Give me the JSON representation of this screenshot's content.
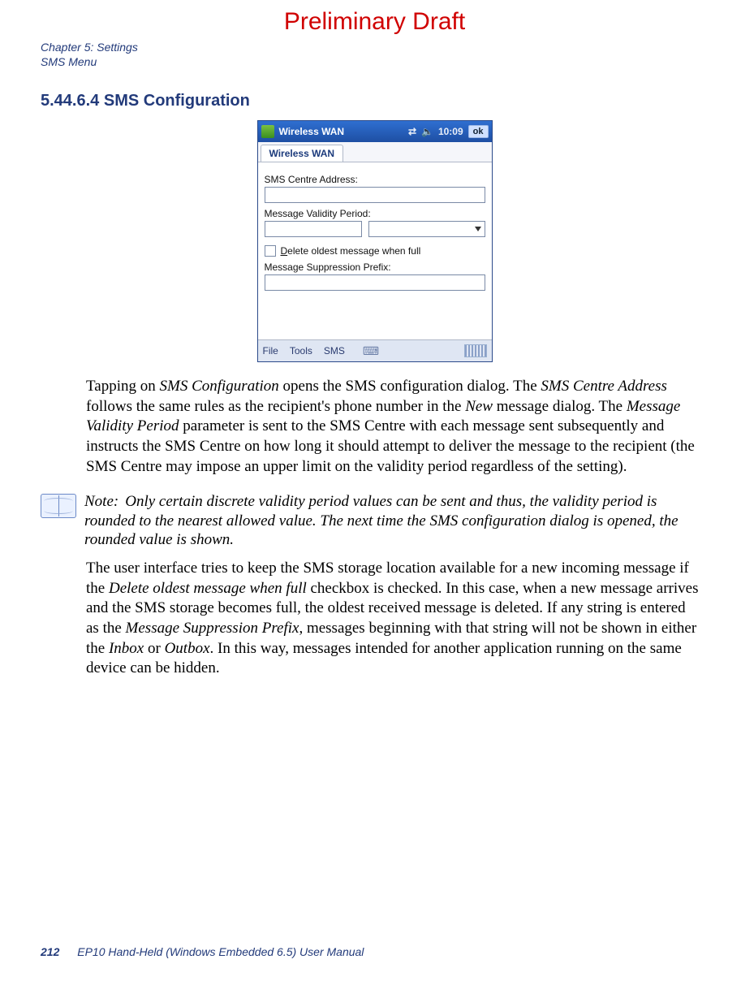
{
  "draft_header": "Preliminary Draft",
  "chapter_line": "Chapter 5: Settings",
  "sub_line": "SMS Menu",
  "section_number": "5.44.6.4",
  "section_title": "SMS Configuration",
  "screenshot": {
    "titlebar_app": "Wireless WAN",
    "clock": "10:09",
    "ok": "ok",
    "tab_label": "Wireless WAN",
    "lbl_centre": "SMS Centre Address:",
    "lbl_validity": "Message Validity Period:",
    "chk_prefix": "D",
    "chk_rest": "elete oldest message when full",
    "lbl_suppression": "Message Suppression Prefix:",
    "menu_file": "File",
    "menu_tools": "Tools",
    "menu_sms": "SMS"
  },
  "para1_a": "Tapping on ",
  "para1_a_em": "SMS Configuration",
  "para1_b": " opens the SMS configuration dialog. The ",
  "para1_b_em": "SMS Centre Address",
  "para1_c": " follows the same rules as the recipient's phone number in the ",
  "para1_c_em": "New",
  "para1_d": " message dialog. The ",
  "para1_d_em": "Message Validity Period",
  "para1_e": " parameter is sent to the SMS Centre with each message sent subsequently and instructs the SMS Centre on how long it should attempt to deliver the message to the recipient (the SMS Centre may impose an upper limit on the validity period regardless of the setting).",
  "note_label": "Note:",
  "note_text": "Only certain discrete validity period values can be sent and thus, the validity period is rounded to the nearest allowed value. The next time the SMS configuration dialog is opened, the rounded value is shown.",
  "para2_a": "The user interface tries to keep the SMS storage location available for a new incoming message if the ",
  "para2_a_em": "Delete oldest message when full",
  "para2_b": " checkbox is checked. In this case, when a new message arrives and the SMS storage becomes full, the oldest received message is deleted. If any string is entered as the ",
  "para2_b_em": "Message Suppression Prefix",
  "para2_c": ", messages beginning with that string will not be shown in either the ",
  "para2_c_em1": "Inbox",
  "para2_d": " or ",
  "para2_d_em": "Outbox",
  "para2_e": ". In this way, messages intended for another application running on the same device can be hidden.",
  "footer_page": "212",
  "footer_title": "EP10 Hand-Held (Windows Embedded 6.5) User Manual"
}
